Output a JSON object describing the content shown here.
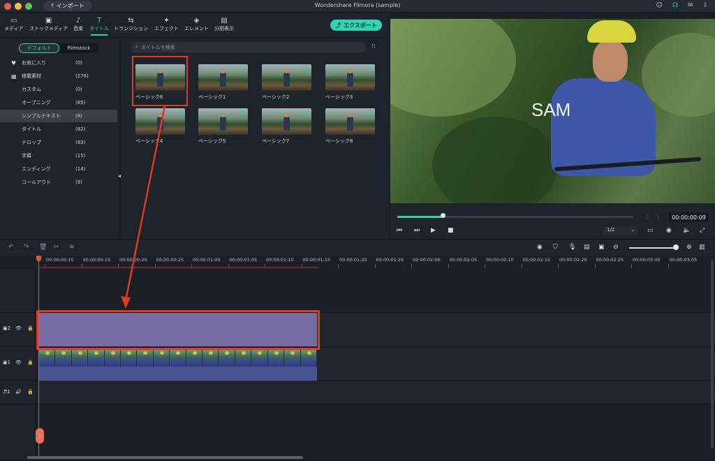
{
  "window": {
    "title": "Wondershare Filmora (sample)",
    "import_label": "インポート"
  },
  "toolbar": {
    "tabs": [
      {
        "label": "メディア",
        "icon": "folder-icon"
      },
      {
        "label": "ストックメディア",
        "icon": "stock-media-icon"
      },
      {
        "label": "音楽",
        "icon": "music-icon"
      },
      {
        "label": "タイトル",
        "icon": "title-icon",
        "active": true
      },
      {
        "label": "トランジション",
        "icon": "transition-icon"
      },
      {
        "label": "エフェクト",
        "icon": "effect-icon"
      },
      {
        "label": "エレメント",
        "icon": "element-icon"
      },
      {
        "label": "分割表示",
        "icon": "split-screen-icon"
      }
    ],
    "export_label": "エクスポート"
  },
  "library": {
    "segments": [
      "デフォルト",
      "Filmstock"
    ],
    "categories": [
      {
        "label": "お気に入り",
        "count": "(0)",
        "icon": "heart-icon"
      },
      {
        "label": "搭載素材",
        "count": "(276)",
        "icon": "grid-icon"
      },
      {
        "label": "カスタム",
        "count": "(0)"
      },
      {
        "label": "オープニング",
        "count": "(65)"
      },
      {
        "label": "シンプルテキスト",
        "count": "(8)",
        "selected": true
      },
      {
        "label": "タイトル",
        "count": "(82)"
      },
      {
        "label": "テロップ",
        "count": "(83)"
      },
      {
        "label": "字幕",
        "count": "(15)"
      },
      {
        "label": "エンディング",
        "count": "(14)"
      },
      {
        "label": "コールアウト",
        "count": "(9)"
      }
    ]
  },
  "grid": {
    "search_placeholder": "タイトルを検索",
    "items": [
      {
        "label": "ベーシック6",
        "download": false
      },
      {
        "label": "ベーシック1",
        "download": true
      },
      {
        "label": "ベーシック2",
        "download": true
      },
      {
        "label": "ベーシック3",
        "download": true
      },
      {
        "label": "ベーシック4",
        "download": true
      },
      {
        "label": "ベーシック5",
        "download": true
      },
      {
        "label": "ベーシック7",
        "download": true
      },
      {
        "label": "ベーシック8",
        "download": true
      }
    ]
  },
  "preview": {
    "overlay_text": "SAM",
    "timecode": "00:00:00:09",
    "progress": 0.19,
    "zoom": "1/2"
  },
  "timeline": {
    "ruler_labels": [
      "00:00:00:10",
      "00:00:00:15",
      "00:00:00:20",
      "00:00:00:25",
      "00:00:01:00",
      "00:00:01:05",
      "00:00:01:10",
      "00:00:01:15",
      "00:00:01:20",
      "00:00:01:25",
      "00:00:02:00",
      "00:00:02:05",
      "00:00:02:10",
      "00:00:02:15",
      "00:00:02:20",
      "00:00:02:25",
      "00:00:03:00",
      "00:00:03:05"
    ],
    "tracks": [
      {
        "label": "2",
        "type": "video"
      },
      {
        "label": "1",
        "type": "video"
      },
      {
        "label": "1",
        "type": "audio"
      }
    ]
  },
  "colors": {
    "accent": "#2fd5b3",
    "highlight": "#e03a22",
    "title_clip": "#776ea6",
    "video_clip": "#4b5495"
  }
}
